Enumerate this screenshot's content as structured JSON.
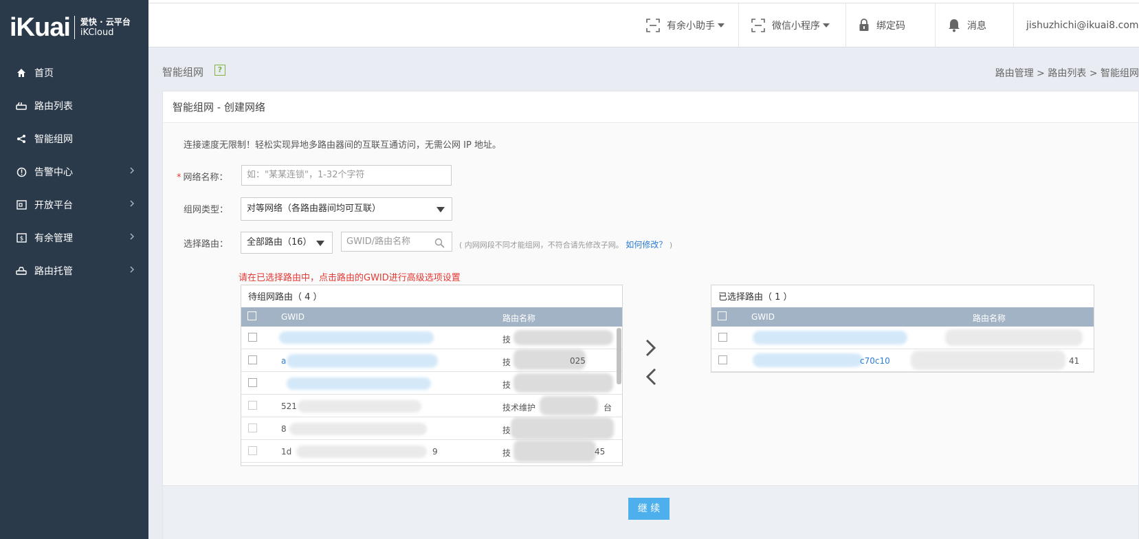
{
  "brand": {
    "logo_main": "iKuai",
    "logo_line1": "爱快 · 云平台",
    "logo_line2": "iKCloud"
  },
  "sidebar": {
    "items": [
      {
        "label": "首页",
        "icon": "home-icon",
        "has_arrow": false
      },
      {
        "label": "路由列表",
        "icon": "router-icon",
        "has_arrow": false
      },
      {
        "label": "智能组网",
        "icon": "share-icon",
        "has_arrow": false
      },
      {
        "label": "告警中心",
        "icon": "alert-icon",
        "has_arrow": true
      },
      {
        "label": "开放平台",
        "icon": "platform-icon",
        "has_arrow": true
      },
      {
        "label": "有余管理",
        "icon": "money-icon",
        "has_arrow": true
      },
      {
        "label": "路由托管",
        "icon": "hosting-icon",
        "has_arrow": true
      }
    ]
  },
  "topbar": {
    "assistant": "有余小助手",
    "miniprogram": "微信小程序",
    "bindcode": "绑定码",
    "messages": "消息",
    "user": "jishuzhichi@ikuai8.com"
  },
  "page": {
    "title": "智能组网",
    "help": "?",
    "breadcrumb": "路由管理 > 路由列表 > 智能组网"
  },
  "panel": {
    "title": "智能组网 - 创建网络",
    "intro": "连接速度无限制！轻松实现异地多路由器间的互联互通访问，无需公网 IP 地址。",
    "name_label": "网络名称：",
    "name_placeholder": "如：\"某某连锁\"，1-32个字符",
    "type_label": "组网类型：",
    "type_value": "对等网络（各路由器间均可互联）",
    "route_label": "选择路由：",
    "route_filter": "全部路由（16）",
    "search_placeholder": "GWID/路由名称",
    "hint": "( 内网网段不同才能组网，不符合请先修改子网。",
    "hint_link": "如何修改？",
    "hint_end": ")",
    "warning": "请在已选择路由中，点击路由的GWID进行高级选项设置",
    "continue": "继 续"
  },
  "pending_table": {
    "caption": "待组网路由（ 4 ）",
    "col_gwid": "GWID",
    "col_name": "路由名称",
    "rows": [
      {
        "gwid": "",
        "name": "技",
        "gwid_link": false
      },
      {
        "gwid": "a",
        "name": "技",
        "gwid_link": true,
        "gwid_tail": "",
        "name_tail": "025"
      },
      {
        "gwid": "",
        "name": "技",
        "gwid_link": true
      },
      {
        "gwid": "521",
        "name": "技术维护",
        "gwid_link": false,
        "name_tail": "台"
      },
      {
        "gwid": "8",
        "name": "技",
        "gwid_link": false
      },
      {
        "gwid": "1d",
        "name": "技",
        "gwid_link": false,
        "gwid_tail": "9",
        "name_tail": "45"
      }
    ]
  },
  "selected_table": {
    "caption": "已选择路由（ 1 ）",
    "col_gwid": "GWID",
    "col_name": "路由名称",
    "rows": [
      {
        "gwid": "",
        "name": ""
      },
      {
        "gwid": "c70c10",
        "name": "41"
      }
    ]
  }
}
